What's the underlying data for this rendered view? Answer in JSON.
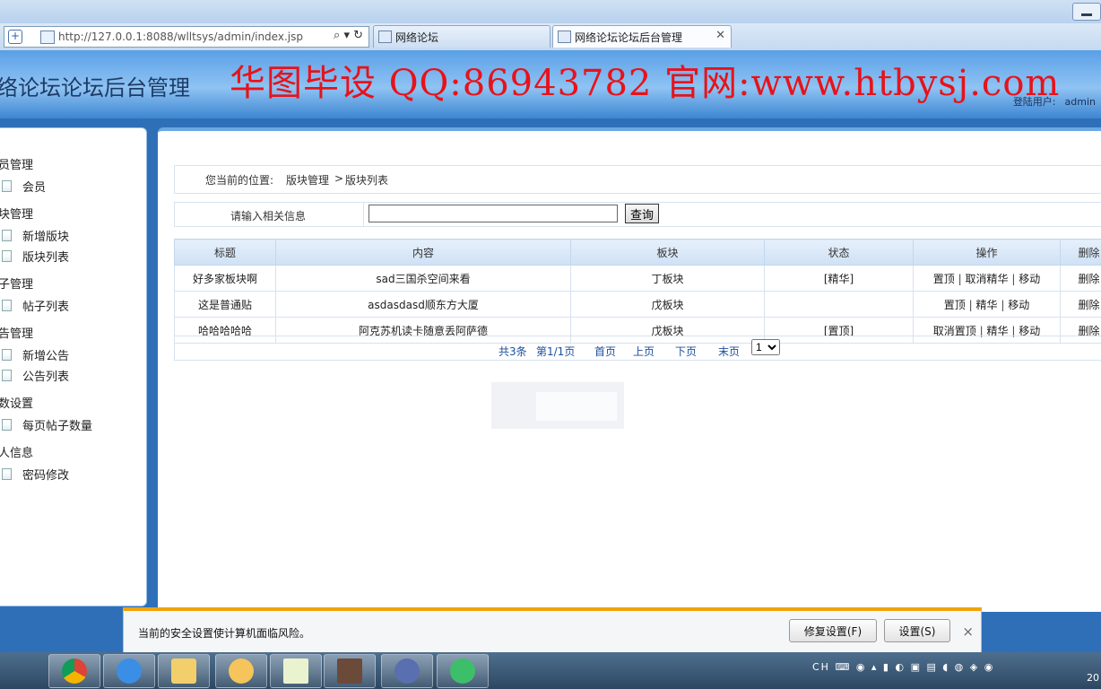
{
  "browser": {
    "url": "http://127.0.0.1:8088/wlltsys/admin/index.jsp",
    "tabs": [
      {
        "label": "网络论坛",
        "active": false
      },
      {
        "label": "网络论坛论坛后台管理",
        "active": true
      }
    ]
  },
  "header": {
    "site_title": "络论坛论坛后台管理",
    "watermark": "华图毕设 QQ:86943782 官网:www.htbysj.com",
    "login_label": "登陆用户:",
    "login_user": "admin"
  },
  "sidebar": {
    "groups": [
      {
        "title": "员管理",
        "items": [
          "会员"
        ]
      },
      {
        "title": "块管理",
        "items": [
          "新增版块",
          "版块列表"
        ]
      },
      {
        "title": "子管理",
        "items": [
          "帖子列表"
        ]
      },
      {
        "title": "告管理",
        "items": [
          "新增公告",
          "公告列表"
        ]
      },
      {
        "title": "数设置",
        "items": [
          "每页帖子数量"
        ]
      },
      {
        "title": "人信息",
        "items": [
          "密码修改"
        ]
      }
    ]
  },
  "breadcrumb": {
    "prefix": "您当前的位置:",
    "level1": "版块管理",
    "separator": ">",
    "level2": "版块列表"
  },
  "search": {
    "label": "请输入相关信息",
    "value": "",
    "button": "查询"
  },
  "table": {
    "headers": [
      "标题",
      "内容",
      "板块",
      "状态",
      "操作",
      "删除"
    ],
    "rows": [
      {
        "title": "好多家板块啊",
        "content": "sad三国杀空间来看",
        "board": "丁板块",
        "status": "[精华]",
        "ops": [
          "置顶",
          "取消精华",
          "移动"
        ],
        "delete": "删除"
      },
      {
        "title": "这是普通贴",
        "content": "asdasdasd顺东方大厦",
        "board": "戊板块",
        "status": "",
        "ops": [
          "置顶",
          "精华",
          "移动"
        ],
        "delete": "删除"
      },
      {
        "title": "哈哈哈哈哈",
        "content": "阿克苏机读卡随意丢阿萨德",
        "board": "戊板块",
        "status": "[置顶]",
        "ops": [
          "取消置顶",
          "精华",
          "移动"
        ],
        "delete": "删除"
      }
    ],
    "op_separator": "|"
  },
  "pager": {
    "total": "共3条",
    "page": "第1/1页",
    "first": "首页",
    "prev": "上页",
    "next": "下页",
    "last": "末页",
    "selected": "1"
  },
  "security_bar": {
    "message": "当前的安全设置使计算机面临风险。",
    "fix_button": "修复设置(F)",
    "settings_button": "设置(S)",
    "close": "×"
  },
  "taskbar": {
    "tray_text": "CH",
    "clock": "20"
  },
  "colors": {
    "header_blue": "#5aa0e6",
    "watermark_red": "#e8121a",
    "warning_orange": "#f0a30a",
    "pager_link": "#1c4f9c"
  }
}
